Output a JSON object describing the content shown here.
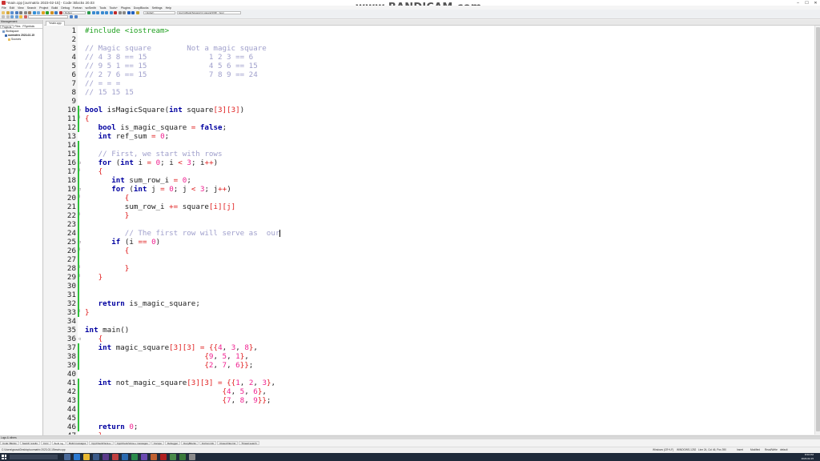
{
  "window": {
    "title": "*main.cpp [ourmatrix 2023-02-15] - Code::Blocks 20.03"
  },
  "watermark": "www.BANDICAM.com",
  "menu": [
    "File",
    "Edit",
    "View",
    "Search",
    "Project",
    "Build",
    "Debug",
    "Fortran",
    "wxSmith",
    "Tools",
    "Tools+",
    "Plugins",
    "DoxyBlocks",
    "Settings",
    "Help"
  ],
  "toolbar": {
    "build_target": "Debug",
    "scope": "<global>",
    "function": "bool isMagicSquare(int square[3][3]) : bool"
  },
  "management": {
    "header": "Management",
    "tabs": [
      "Projects",
      "Files",
      "FSymbols"
    ],
    "tree": [
      "Workspace",
      "ourmatrix 2023-02-15",
      "Sources"
    ]
  },
  "editor": {
    "tab_label": "*main.cpp",
    "lines": [
      [
        [
          "pp",
          "#include <iostream>"
        ]
      ],
      [],
      [
        [
          "cm",
          "// Magic square        Not a magic square"
        ]
      ],
      [
        [
          "cm",
          "// 4 3 8 == 15              1 2 3 == 6"
        ]
      ],
      [
        [
          "cm",
          "// 9 5 1 == 15              4 5 6 == 15"
        ]
      ],
      [
        [
          "cm",
          "// 2 7 6 == 15              7 8 9 == 24"
        ]
      ],
      [
        [
          "cm",
          "// = = ="
        ]
      ],
      [
        [
          "cm",
          "// 15 15 15"
        ]
      ],
      [],
      [
        [
          "kw",
          "bool"
        ],
        [
          "t",
          " isMagicSquare("
        ],
        [
          "kw",
          "int"
        ],
        [
          "t",
          " square"
        ],
        [
          "brc",
          "[3][3]"
        ],
        [
          "t",
          ")"
        ]
      ],
      [
        [
          "brc",
          "{"
        ]
      ],
      [
        [
          "t",
          "   "
        ],
        [
          "kw",
          "bool"
        ],
        [
          "t",
          " is_magic_square "
        ],
        [
          "op",
          "="
        ],
        [
          "t",
          " "
        ],
        [
          "kw",
          "false"
        ],
        [
          "t",
          ";"
        ]
      ],
      [
        [
          "t",
          "   "
        ],
        [
          "kw",
          "int"
        ],
        [
          "t",
          " ref_sum "
        ],
        [
          "op",
          "="
        ],
        [
          "t",
          " "
        ],
        [
          "num",
          "0"
        ],
        [
          "t",
          ";"
        ]
      ],
      [],
      [
        [
          "t",
          "   "
        ],
        [
          "cm",
          "// First, we start with rows"
        ]
      ],
      [
        [
          "t",
          "   "
        ],
        [
          "kw",
          "for"
        ],
        [
          "t",
          " ("
        ],
        [
          "kw",
          "int"
        ],
        [
          "t",
          " i "
        ],
        [
          "op",
          "="
        ],
        [
          "t",
          " "
        ],
        [
          "num",
          "0"
        ],
        [
          "t",
          "; i "
        ],
        [
          "op",
          "<"
        ],
        [
          "t",
          " "
        ],
        [
          "num",
          "3"
        ],
        [
          "t",
          "; i"
        ],
        [
          "op",
          "++"
        ],
        [
          "t",
          ")"
        ]
      ],
      [
        [
          "t",
          "   "
        ],
        [
          "brc",
          "{"
        ]
      ],
      [
        [
          "t",
          "      "
        ],
        [
          "kw",
          "int"
        ],
        [
          "t",
          " sum_row_i "
        ],
        [
          "op",
          "="
        ],
        [
          "t",
          " "
        ],
        [
          "num",
          "0"
        ],
        [
          "t",
          ";"
        ]
      ],
      [
        [
          "t",
          "      "
        ],
        [
          "kw",
          "for"
        ],
        [
          "t",
          " ("
        ],
        [
          "kw",
          "int"
        ],
        [
          "t",
          " j "
        ],
        [
          "op",
          "="
        ],
        [
          "t",
          " "
        ],
        [
          "num",
          "0"
        ],
        [
          "t",
          "; j "
        ],
        [
          "op",
          "<"
        ],
        [
          "t",
          " "
        ],
        [
          "num",
          "3"
        ],
        [
          "t",
          "; j"
        ],
        [
          "op",
          "++"
        ],
        [
          "t",
          ")"
        ]
      ],
      [
        [
          "t",
          "         "
        ],
        [
          "brc",
          "{"
        ]
      ],
      [
        [
          "t",
          "         sum_row_i "
        ],
        [
          "op",
          "+="
        ],
        [
          "t",
          " square"
        ],
        [
          "brc",
          "[i][j]"
        ]
      ],
      [
        [
          "t",
          "         "
        ],
        [
          "brc",
          "}"
        ]
      ],
      [],
      [
        [
          "t",
          "         "
        ],
        [
          "cm",
          "// The first row will serve as  our"
        ]
      ],
      [
        [
          "t",
          "      "
        ],
        [
          "kw",
          "if"
        ],
        [
          "t",
          " ("
        ],
        [
          "t",
          "i "
        ],
        [
          "op",
          "=="
        ],
        [
          "t",
          " "
        ],
        [
          "num",
          "0"
        ],
        [
          "t",
          ")"
        ]
      ],
      [
        [
          "t",
          "         "
        ],
        [
          "brc",
          "{"
        ]
      ],
      [],
      [
        [
          "t",
          "         "
        ],
        [
          "brc",
          "}"
        ]
      ],
      [
        [
          "t",
          "   "
        ],
        [
          "brc",
          "}"
        ]
      ],
      [],
      [],
      [
        [
          "t",
          "   "
        ],
        [
          "kw",
          "return"
        ],
        [
          "t",
          " is_magic_square;"
        ]
      ],
      [
        [
          "brc",
          "}"
        ]
      ],
      [],
      [
        [
          "kw",
          "int"
        ],
        [
          "t",
          " main()"
        ]
      ],
      [
        [
          "t",
          "   "
        ],
        [
          "brc",
          "{"
        ]
      ],
      [
        [
          "t",
          "   "
        ],
        [
          "kw",
          "int"
        ],
        [
          "t",
          " magic_square"
        ],
        [
          "brc",
          "[3][3]"
        ],
        [
          "t",
          " "
        ],
        [
          "op",
          "="
        ],
        [
          "t",
          " "
        ],
        [
          "brc",
          "{{"
        ],
        [
          "num",
          "4"
        ],
        [
          "t",
          ", "
        ],
        [
          "num",
          "3"
        ],
        [
          "t",
          ", "
        ],
        [
          "num",
          "8"
        ],
        [
          "brc",
          "}"
        ],
        [
          "t",
          ","
        ]
      ],
      [
        [
          "t",
          "                           "
        ],
        [
          "brc",
          "{"
        ],
        [
          "num",
          "9"
        ],
        [
          "t",
          ", "
        ],
        [
          "num",
          "5"
        ],
        [
          "t",
          ", "
        ],
        [
          "num",
          "1"
        ],
        [
          "brc",
          "}"
        ],
        [
          "t",
          ","
        ]
      ],
      [
        [
          "t",
          "                           "
        ],
        [
          "brc",
          "{"
        ],
        [
          "num",
          "2"
        ],
        [
          "t",
          ", "
        ],
        [
          "num",
          "7"
        ],
        [
          "t",
          ", "
        ],
        [
          "num",
          "6"
        ],
        [
          "brc",
          "}}"
        ],
        [
          "t",
          ";"
        ]
      ],
      [],
      [
        [
          "t",
          "   "
        ],
        [
          "kw",
          "int"
        ],
        [
          "t",
          " not_magic_square"
        ],
        [
          "brc",
          "[3][3]"
        ],
        [
          "t",
          " "
        ],
        [
          "op",
          "="
        ],
        [
          "t",
          " "
        ],
        [
          "brc",
          "{{"
        ],
        [
          "num",
          "1"
        ],
        [
          "t",
          ", "
        ],
        [
          "num",
          "2"
        ],
        [
          "t",
          ", "
        ],
        [
          "num",
          "3"
        ],
        [
          "brc",
          "}"
        ],
        [
          "t",
          ","
        ]
      ],
      [
        [
          "t",
          "                               "
        ],
        [
          "brc",
          "{"
        ],
        [
          "num",
          "4"
        ],
        [
          "t",
          ", "
        ],
        [
          "num",
          "5"
        ],
        [
          "t",
          ", "
        ],
        [
          "num",
          "6"
        ],
        [
          "brc",
          "}"
        ],
        [
          "t",
          ","
        ]
      ],
      [
        [
          "t",
          "                               "
        ],
        [
          "brc",
          "{"
        ],
        [
          "num",
          "7"
        ],
        [
          "t",
          ", "
        ],
        [
          "num",
          "8"
        ],
        [
          "t",
          ", "
        ],
        [
          "num",
          "9"
        ],
        [
          "brc",
          "}}"
        ],
        [
          "t",
          ";"
        ]
      ],
      [],
      [],
      [
        [
          "t",
          "   "
        ],
        [
          "kw",
          "return"
        ],
        [
          "t",
          " "
        ],
        [
          "num",
          "0"
        ],
        [
          "t",
          ";"
        ]
      ],
      [
        [
          "t",
          "   "
        ],
        [
          "brc",
          "}"
        ]
      ]
    ]
  },
  "logs": {
    "header": "Logs & others",
    "tabs": [
      "Code::Blocks",
      "Search results",
      "Cccc",
      "Build log",
      "Build messages",
      "CppCheck/Vera++",
      "CppCheck/Vera++ messages",
      "Cscope",
      "Debugger",
      "DoxyBlocks",
      "Fortran info",
      "Closed files list",
      "Thread search"
    ]
  },
  "status": {
    "path": "C:\\Users\\gsosa\\Desktop\\ourmatrix 2023-02-15\\main.cpp",
    "eol": "Windows (CR+LF)",
    "encoding": "WINDOWS-1252",
    "position": "Line 24, Col 46, Pos 390",
    "mode": "Insert",
    "access": "Modified",
    "rw": "Read/Write",
    "profile": "default"
  },
  "clock": {
    "time": "8:50 PM",
    "date": "2023-02-15"
  }
}
